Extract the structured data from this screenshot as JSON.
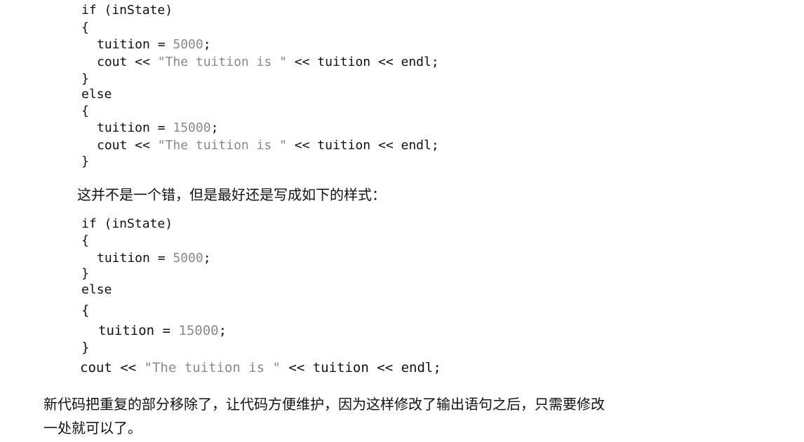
{
  "block1": {
    "l1": "if (inState)",
    "l2": "{",
    "l3_code": "tuition = ",
    "l3_num": "5000",
    "l3_end": ";",
    "l4_a": "cout << ",
    "l4_str": "\"The tuition is \"",
    "l4_b": " << tuition << endl;",
    "l5": "}",
    "l6": "else",
    "l7": "{",
    "l8_code": "tuition = ",
    "l8_num": "15000",
    "l8_end": ";",
    "l9_a": "cout << ",
    "l9_str": "\"The tuition is \"",
    "l9_b": " << tuition << endl;",
    "l10": "}"
  },
  "text1": "这并不是一个错，但是最好还是写成如下的样式：",
  "block2": {
    "l1": "if (inState)",
    "l2": "{",
    "l3_code": "tuition = ",
    "l3_num": "5000",
    "l3_end": ";",
    "l4": "}",
    "l5": "else",
    "l6": "{",
    "l7_code": "tuition = ",
    "l7_num": "15000",
    "l7_end": ";",
    "l8": "}",
    "l9_a": "cout << ",
    "l9_str": "\"The tuition is \"",
    "l9_b": " << tuition << endl;"
  },
  "text2_line1": "新代码把重复的部分移除了，让代码方便维护，因为这样修改了输出语句之后，只需要修改",
  "text2_line2": "一处就可以了。"
}
